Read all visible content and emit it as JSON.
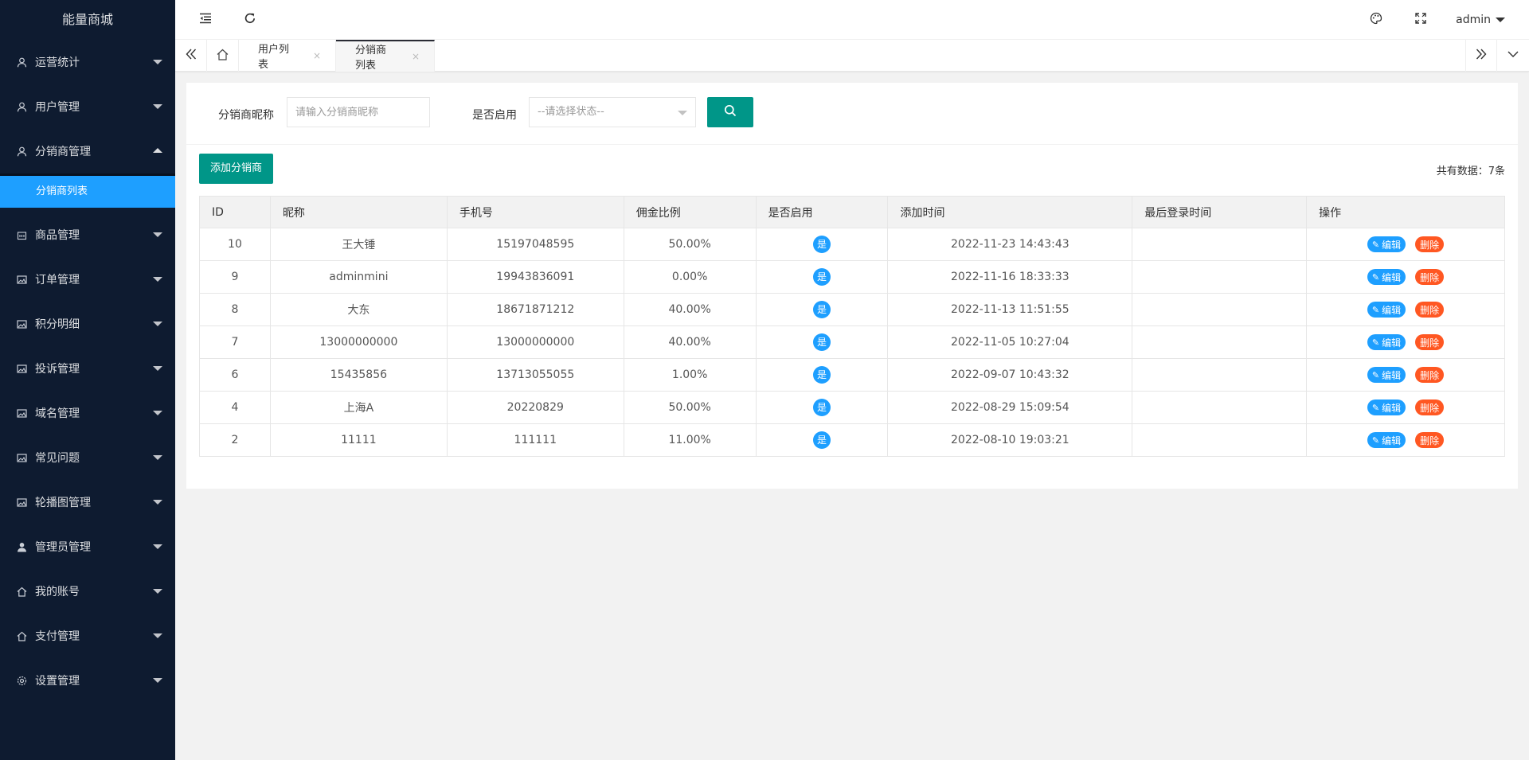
{
  "app": {
    "title": "能量商城"
  },
  "sidebar": {
    "items": [
      {
        "label": "运营统计",
        "icon": "user-icon"
      },
      {
        "label": "用户管理",
        "icon": "user-icon"
      },
      {
        "label": "分销商管理",
        "icon": "user-icon",
        "open": true,
        "children": [
          {
            "label": "分销商列表",
            "active": true
          }
        ]
      },
      {
        "label": "商品管理",
        "icon": "goods-icon"
      },
      {
        "label": "订单管理",
        "icon": "image-icon"
      },
      {
        "label": "积分明细",
        "icon": "image-icon"
      },
      {
        "label": "投诉管理",
        "icon": "image-icon"
      },
      {
        "label": "域名管理",
        "icon": "image-icon"
      },
      {
        "label": "常见问题",
        "icon": "image-icon"
      },
      {
        "label": "轮播图管理",
        "icon": "image-icon"
      },
      {
        "label": "管理员管理",
        "icon": "person-icon"
      },
      {
        "label": "我的账号",
        "icon": "home-icon"
      },
      {
        "label": "支付管理",
        "icon": "home-icon"
      },
      {
        "label": "设置管理",
        "icon": "gear-icon"
      }
    ]
  },
  "header": {
    "user": "admin"
  },
  "tabs": [
    {
      "label": "用户列表",
      "close": "×"
    },
    {
      "label": "分销商列表",
      "close": "×",
      "active": true
    }
  ],
  "filter": {
    "nickname_label": "分销商昵称",
    "nickname_placeholder": "请输入分销商昵称",
    "enabled_label": "是否启用",
    "enabled_placeholder": "--请选择状态--"
  },
  "toolbar": {
    "add_label": "添加分销商",
    "total_label": "共有数据：",
    "total_value": "7条"
  },
  "table": {
    "headers": [
      "ID",
      "昵称",
      "手机号",
      "佣金比例",
      "是否启用",
      "添加时间",
      "最后登录时间",
      "操作"
    ],
    "edit_label": "编辑",
    "delete_label": "删除",
    "rows": [
      {
        "id": "10",
        "nickname": "王大锤",
        "phone": "15197048595",
        "rate": "50.00%",
        "enabled": "是",
        "added": "2022-11-23 14:43:43",
        "last_login": ""
      },
      {
        "id": "9",
        "nickname": "adminmini",
        "phone": "19943836091",
        "rate": "0.00%",
        "enabled": "是",
        "added": "2022-11-16 18:33:33",
        "last_login": ""
      },
      {
        "id": "8",
        "nickname": "大东",
        "phone": "18671871212",
        "rate": "40.00%",
        "enabled": "是",
        "added": "2022-11-13 11:51:55",
        "last_login": ""
      },
      {
        "id": "7",
        "nickname": "13000000000",
        "phone": "13000000000",
        "rate": "40.00%",
        "enabled": "是",
        "added": "2022-11-05 10:27:04",
        "last_login": ""
      },
      {
        "id": "6",
        "nickname": "15435856",
        "phone": "13713055055",
        "rate": "1.00%",
        "enabled": "是",
        "added": "2022-09-07 10:43:32",
        "last_login": ""
      },
      {
        "id": "4",
        "nickname": "上海A",
        "phone": "20220829",
        "rate": "50.00%",
        "enabled": "是",
        "added": "2022-08-29 15:09:54",
        "last_login": ""
      },
      {
        "id": "2",
        "nickname": "11111",
        "phone": "111111",
        "rate": "11.00%",
        "enabled": "是",
        "added": "2022-08-10 19:03:21",
        "last_login": ""
      }
    ]
  },
  "colors": {
    "sidebar_bg": "#0e1b30",
    "active_blue": "#1e9fff",
    "primary_green": "#009688",
    "danger": "#ff5722"
  }
}
